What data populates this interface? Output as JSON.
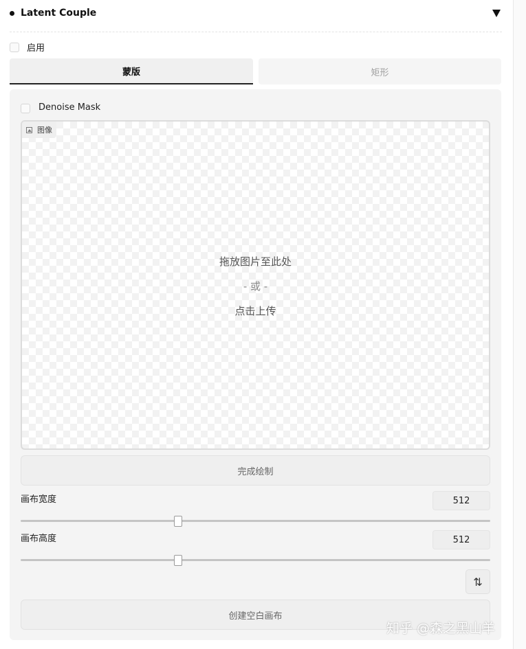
{
  "panel": {
    "title": "Latent Couple",
    "enable_label": "启用",
    "enable_checked": false
  },
  "tabs": [
    {
      "label": "蒙版",
      "active": true
    },
    {
      "label": "矩形",
      "active": false
    }
  ],
  "mask_tab": {
    "denoise_label": "Denoise Mask",
    "denoise_checked": false,
    "image_label": "图像",
    "drop_text": "拖放图片至此处",
    "or_text": "- 或 -",
    "click_text": "点击上传",
    "finish_button": "完成绘制",
    "canvas_width_label": "画布宽度",
    "canvas_width_value": "512",
    "canvas_width_slider": 0.336,
    "canvas_height_label": "画布高度",
    "canvas_height_value": "512",
    "canvas_height_slider": 0.336,
    "swap_icon": "⇅",
    "create_button": "创建空白画布"
  },
  "watermark": "知乎 @森之黑山羊"
}
